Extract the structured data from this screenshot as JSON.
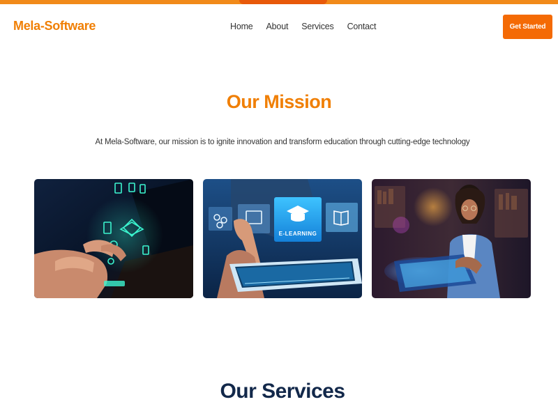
{
  "colors": {
    "brand": "#f07f05",
    "cta_background": "#f46a05",
    "heading_dark": "#12284a",
    "top_strip": "#f18a1a"
  },
  "header": {
    "logo": "Mela-Software",
    "nav": [
      "Home",
      "About",
      "Services",
      "Contact"
    ],
    "cta_label": "Get Started"
  },
  "mission": {
    "title": "Our Mission",
    "text": "At Mela-Software, our mission is to ignite innovation and transform education through cutting-edge technology"
  },
  "mission_images": [
    {
      "subject": "hands typing on a laptop with glowing education icons"
    },
    {
      "subject": "finger touching a tablet with an E-LEARNING icon",
      "overlay_label": "E-LEARNING"
    },
    {
      "subject": "student using a glowing tablet in a library"
    }
  ],
  "services": {
    "title": "Our Services"
  }
}
